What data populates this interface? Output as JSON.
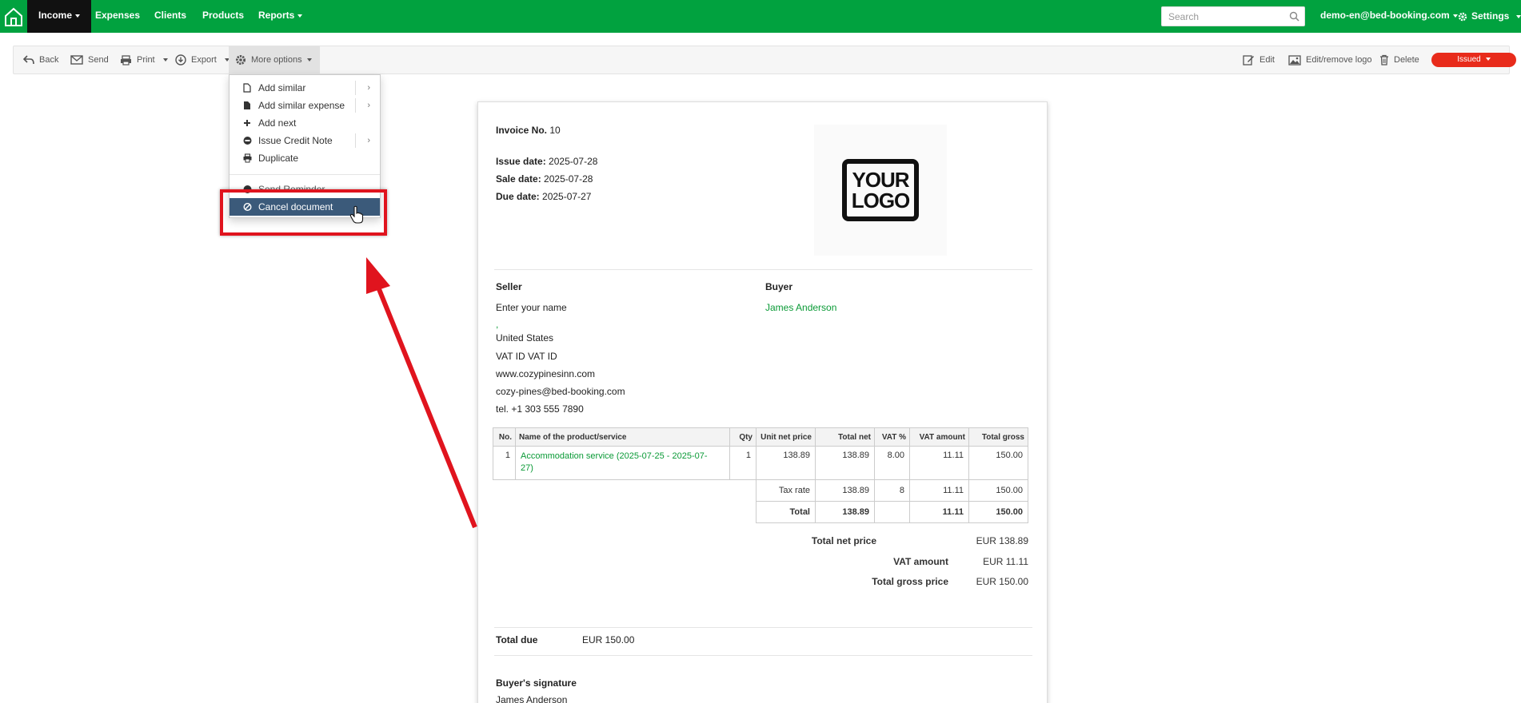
{
  "navbar": {
    "home_icon": "home-icon",
    "items": [
      {
        "label": "Income",
        "active": true,
        "caret": true
      },
      {
        "label": "Expenses"
      },
      {
        "label": "Clients"
      },
      {
        "label": "Products"
      },
      {
        "label": "Reports",
        "caret": true
      }
    ],
    "search_placeholder": "Search",
    "user": "demo-en@bed-booking.com",
    "settings": "Settings",
    "color": "#01a23f"
  },
  "toolbar": {
    "back": "Back",
    "send": "Send",
    "print": "Print",
    "export": "Export",
    "more_options": "More options",
    "edit": "Edit",
    "edit_logo": "Edit/remove logo",
    "delete": "Delete",
    "status": "Issued",
    "status_color": "#e82b1b"
  },
  "menu": {
    "items": [
      {
        "label": "Add similar",
        "icon": "file-icon",
        "submenu": true
      },
      {
        "label": "Add similar expense",
        "icon": "file-filled-icon",
        "submenu": true
      },
      {
        "label": "Add next",
        "icon": "plus-icon"
      },
      {
        "label": "Issue Credit Note",
        "icon": "minus-circle-icon",
        "submenu": true
      },
      {
        "label": "Duplicate",
        "icon": "printer-icon"
      },
      {
        "label": "Send Reminder",
        "icon": "reminder-icon"
      },
      {
        "label": "Cancel document",
        "icon": "cancel-icon",
        "highlighted": true
      }
    ],
    "highlight_color": "#3b5a7a"
  },
  "invoice": {
    "number_label": "Invoice No.",
    "number": "10",
    "issue_date_label": "Issue date:",
    "issue_date": "2025-07-28",
    "sale_date_label": "Sale date:",
    "sale_date": "2025-07-28",
    "due_date_label": "Due date:",
    "due_date": "2025-07-27",
    "logo_line1": "YOUR",
    "logo_line2": "LOGO",
    "seller_label": "Seller",
    "buyer_label": "Buyer",
    "seller": {
      "name": "Enter your name",
      "comma": ",",
      "country": "United States",
      "vat": "VAT ID VAT ID",
      "website": "www.cozypinesinn.com",
      "email": "cozy-pines@bed-booking.com",
      "phone": "tel. +1 303 555 7890"
    },
    "buyer": {
      "name": "James Anderson"
    },
    "table": {
      "headers": [
        "No.",
        "Name of the product/service",
        "Qty",
        "Unit net price",
        "Total net",
        "VAT %",
        "VAT amount",
        "Total gross"
      ],
      "rows": [
        {
          "no": "1",
          "name_line1": "Accommodation service (2025-07-25 - 2025-07-",
          "name_line2": "27)",
          "qty": "1",
          "unit_net": "138.89",
          "total_net": "138.89",
          "vat_pct": "8.00",
          "vat_amount": "11.11",
          "total_gross": "150.00"
        }
      ],
      "tax_rate": {
        "label": "Tax rate",
        "total_net": "138.89",
        "vat_pct": "8",
        "vat_amount": "11.11",
        "total_gross": "150.00"
      },
      "total": {
        "label": "Total",
        "total_net": "138.89",
        "vat_amount": "11.11",
        "total_gross": "150.00"
      }
    },
    "summary": {
      "total_net_label": "Total net price",
      "total_net": "EUR 138.89",
      "vat_label": "VAT amount",
      "vat": "EUR 11.11",
      "total_gross_label": "Total gross price",
      "total_gross": "EUR 150.00"
    },
    "total_due_label": "Total due",
    "total_due": "EUR 150.00",
    "signature_label": "Buyer's signature",
    "signature_name": "James Anderson"
  },
  "annotation": {
    "color": "#e0141e"
  }
}
